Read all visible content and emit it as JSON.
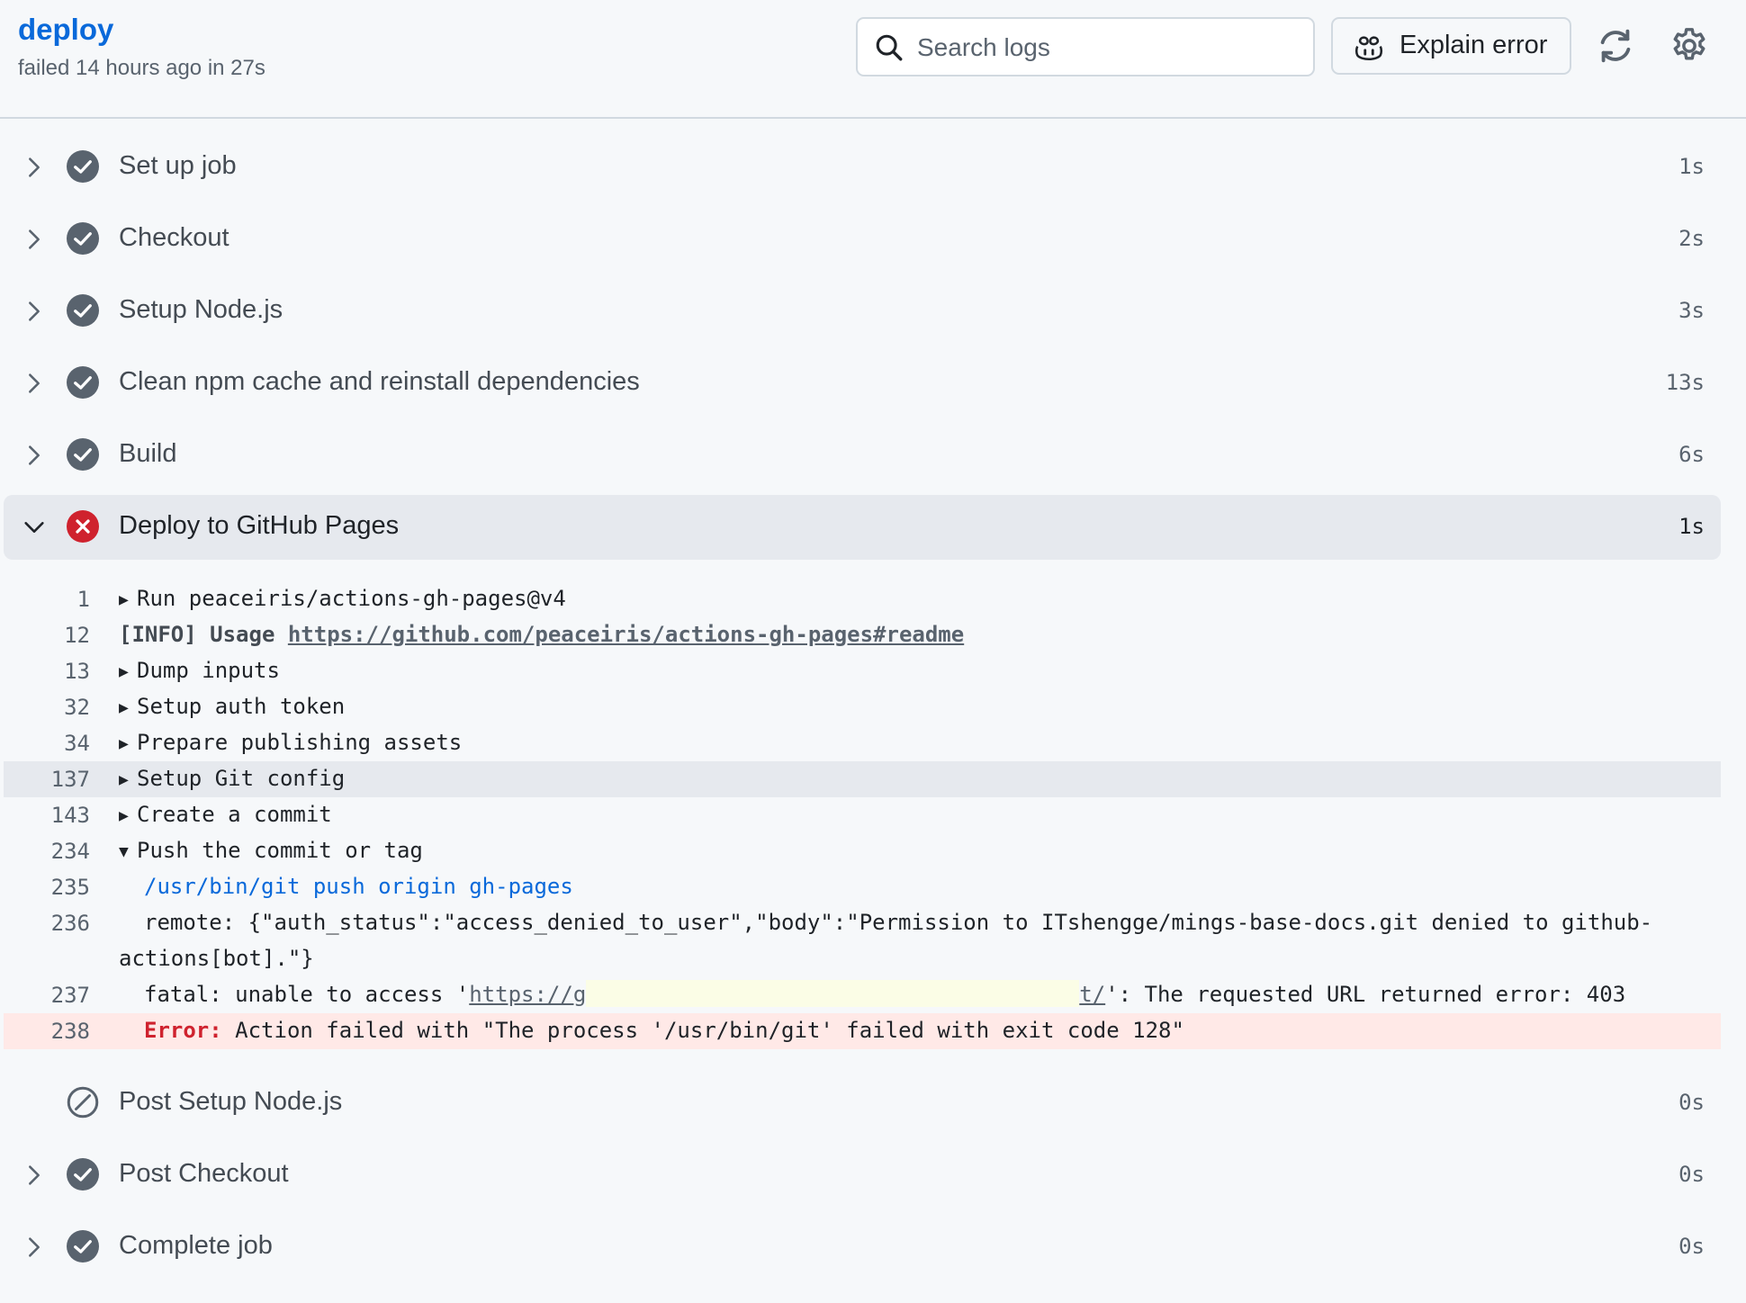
{
  "header": {
    "title": "deploy",
    "subtitle": "failed 14 hours ago in 27s",
    "search_placeholder": "Search logs",
    "explain_label": "Explain error"
  },
  "steps_before": [
    {
      "name": "Set up job",
      "duration": "1s",
      "status": "success"
    },
    {
      "name": "Checkout",
      "duration": "2s",
      "status": "success"
    },
    {
      "name": "Setup Node.js",
      "duration": "3s",
      "status": "success"
    },
    {
      "name": "Clean npm cache and reinstall dependencies",
      "duration": "13s",
      "status": "success"
    },
    {
      "name": "Build",
      "duration": "6s",
      "status": "success"
    }
  ],
  "expanded_step": {
    "name": "Deploy to GitHub Pages",
    "duration": "1s",
    "status": "failure"
  },
  "log": {
    "l1": {
      "num": "1",
      "text": "Run peaceiris/actions-gh-pages@v4"
    },
    "l12": {
      "num": "12",
      "prefix": "[INFO] Usage ",
      "link": "https://github.com/peaceiris/actions-gh-pages#readme"
    },
    "l13": {
      "num": "13",
      "text": "Dump inputs"
    },
    "l32": {
      "num": "32",
      "text": "Setup auth token"
    },
    "l34": {
      "num": "34",
      "text": "Prepare publishing assets"
    },
    "l137": {
      "num": "137",
      "text": "Setup Git config"
    },
    "l143": {
      "num": "143",
      "text": "Create a commit"
    },
    "l234": {
      "num": "234",
      "text": "Push the commit or tag"
    },
    "l235": {
      "num": "235",
      "text": "/usr/bin/git push origin gh-pages"
    },
    "l236": {
      "num": "236",
      "text": "remote: {\"auth_status\":\"access_denied_to_user\",\"body\":\"Permission to ITshengge/mings-base-docs.git denied to github-actions[bot].\"}"
    },
    "l237": {
      "num": "237",
      "pre": "fatal: unable to access '",
      "url_start": "https://g",
      "url_end": "t/",
      "post": "': The requested URL returned error: 403"
    },
    "l238": {
      "num": "238",
      "label": "Error:",
      "text": " Action failed with \"The process '/usr/bin/git' failed with exit code 128\""
    }
  },
  "steps_after": [
    {
      "name": "Post Setup Node.js",
      "duration": "0s",
      "status": "skipped"
    },
    {
      "name": "Post Checkout",
      "duration": "0s",
      "status": "success"
    },
    {
      "name": "Complete job",
      "duration": "0s",
      "status": "success"
    }
  ],
  "colors": {
    "link": "#0969da",
    "success": "#59636e",
    "failure": "#cf222e",
    "error_bg": "#ffe9e7"
  }
}
